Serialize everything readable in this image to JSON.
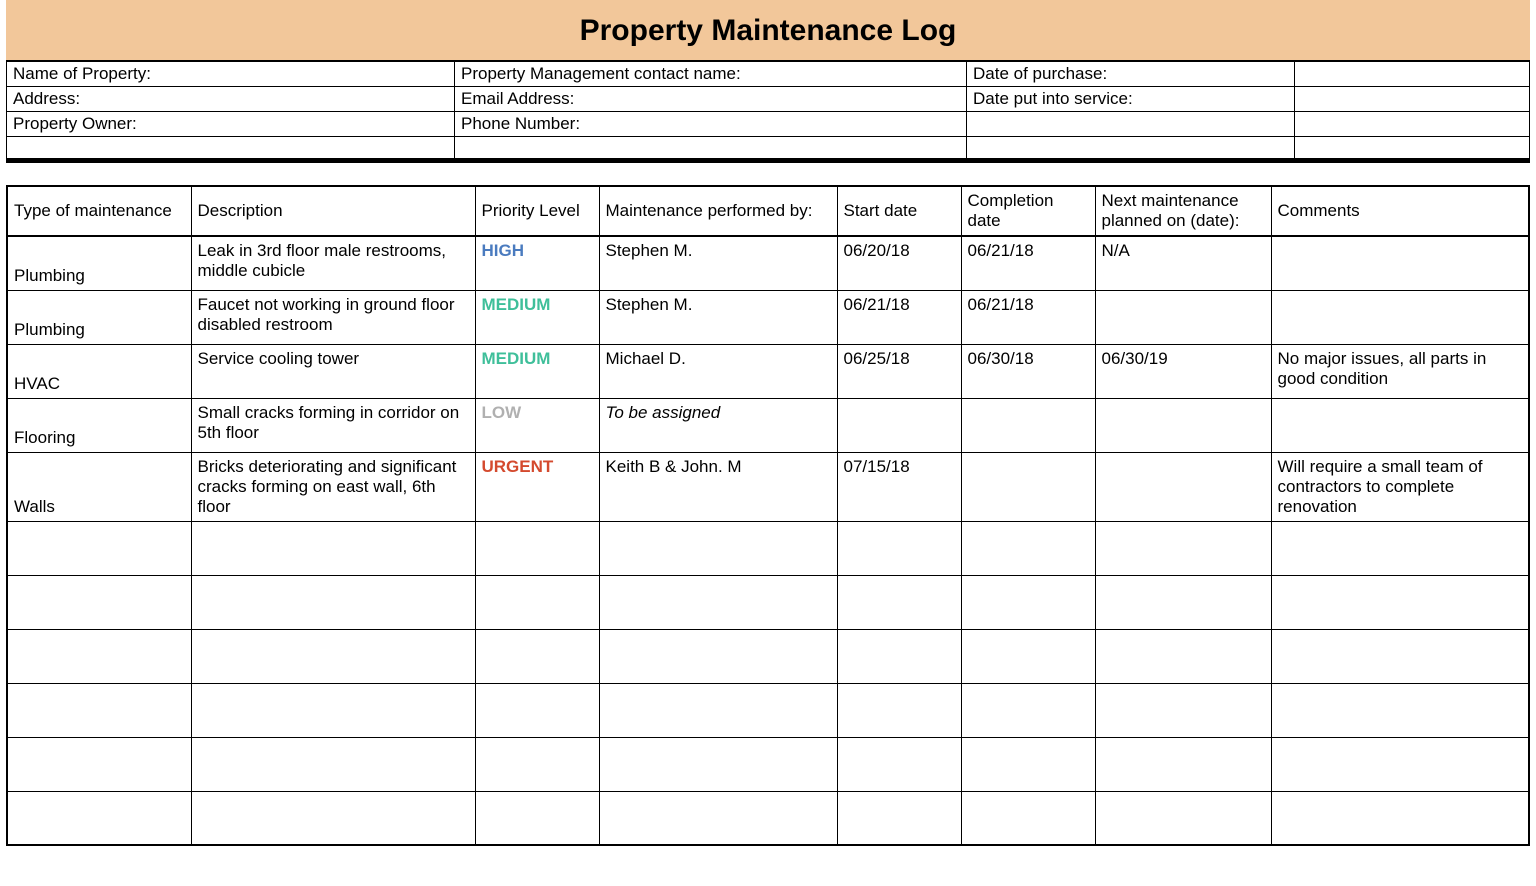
{
  "title": "Property Maintenance Log",
  "info": {
    "r1c1": "Name of Property:",
    "r1c2": "Property Management contact name:",
    "r1c3": "Date of purchase:",
    "r2c1": "Address:",
    "r2c2": "Email Address:",
    "r2c3": "Date put into service:",
    "r3c1": "Property Owner:",
    "r3c2": "Phone Number:",
    "r3c3": "",
    "r4c1": "",
    "r4c2": "",
    "r4c3": ""
  },
  "columns": {
    "type": "Type of maintenance",
    "desc": "Description",
    "priority": "Priority Level",
    "by": "Maintenance performed by:",
    "start": "Start date",
    "completion": "Completion date",
    "next": "Next maintenance planned on (date):",
    "comments": "Comments"
  },
  "rows": [
    {
      "type": "Plumbing",
      "desc": "Leak in 3rd floor male restrooms, middle cubicle",
      "priority": "HIGH",
      "priority_class": "p-high",
      "by": "Stephen M.",
      "by_italic": false,
      "start": "06/20/18",
      "completion": "06/21/18",
      "next": "N/A",
      "comments": ""
    },
    {
      "type": "Plumbing",
      "desc": "Faucet not working in ground floor disabled restroom",
      "priority": "MEDIUM",
      "priority_class": "p-medium",
      "by": "Stephen M.",
      "by_italic": false,
      "start": "06/21/18",
      "completion": "06/21/18",
      "next": "",
      "comments": ""
    },
    {
      "type": "HVAC",
      "desc": "Service cooling tower",
      "priority": "MEDIUM",
      "priority_class": "p-medium",
      "by": "Michael D.",
      "by_italic": false,
      "start": "06/25/18",
      "completion": "06/30/18",
      "next": "06/30/19",
      "comments": "No major issues, all parts in good condition"
    },
    {
      "type": "Flooring",
      "desc": "Small cracks forming in corridor on 5th floor",
      "priority": "LOW",
      "priority_class": "p-low",
      "by": "To be assigned",
      "by_italic": true,
      "start": "",
      "completion": "",
      "next": "",
      "comments": ""
    },
    {
      "type": "Walls",
      "desc": "Bricks deteriorating and significant cracks forming on east wall, 6th floor",
      "priority": "URGENT",
      "priority_class": "p-urgent",
      "by": "Keith B & John. M",
      "by_italic": false,
      "start": "07/15/18",
      "completion": "",
      "next": "",
      "comments": "Will require a small team of contractors to complete renovation"
    }
  ],
  "blank_row_count": 6
}
